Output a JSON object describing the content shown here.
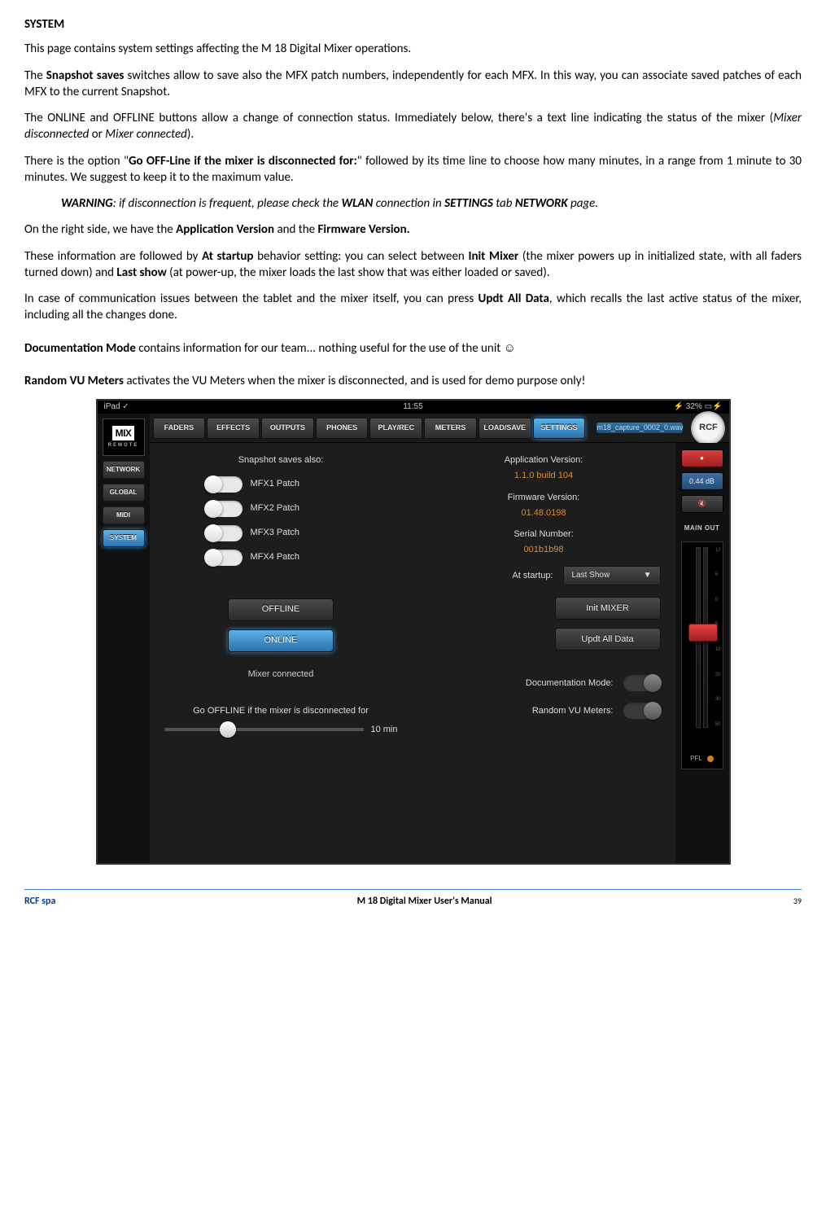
{
  "doc": {
    "section_title": "SYSTEM",
    "p1": "This page contains system settings affecting the M 18 Digital Mixer operations.",
    "p2_a": "The ",
    "p2_b": "Snapshot saves",
    "p2_c": " switches allow to save also the MFX patch numbers, independently for each MFX. In this way, you can associate saved patches of each MFX to the current Snapshot.",
    "p3_a": "The ONLINE and OFFLINE buttons allow a change of connection status. Immediately below, there's a text line indicating the status of the mixer (",
    "p3_b": "Mixer disconnected",
    "p3_c": " or ",
    "p3_d": "Mixer connected",
    "p3_e": ").",
    "p4_a": "There is the option \"",
    "p4_b": "Go OFF-Line if the mixer is disconnected for:",
    "p4_c": "\" followed by its time line to choose how many minutes, in a range from 1 minute to 30 minutes. We suggest to keep it to the maximum value.",
    "p5_a": "WARNING",
    "p5_b": ": if disconnection is frequent, please check the ",
    "p5_c": "WLAN",
    "p5_d": " connection in  ",
    "p5_e": "SETTINGS",
    "p5_f": " tab ",
    "p5_g": "NETWORK",
    "p5_h": " page.",
    "p6_a": "On the right side, we have the ",
    "p6_b": "Application Version",
    "p6_c": " and the ",
    "p6_d": "Firmware Version.",
    "p7_a": "These information are followed by ",
    "p7_b": "At startup",
    "p7_c": " behavior setting: you can select between ",
    "p7_d": "Init Mixer",
    "p7_e": " (the mixer powers up in initialized state, with all faders turned down) and ",
    "p7_f": "Last show",
    "p7_g": "  (at power-up, the mixer loads the last show that was either loaded or saved).",
    "p8_a": "In case of communication issues between the tablet and the mixer itself, you can press ",
    "p8_b": "Updt All Data",
    "p8_c": ", which recalls the last active status of the mixer, including all the changes done.",
    "p9_a": "Documentation Mode",
    "p9_b": " contains information for our team... nothing useful for the use of the unit ☺",
    "p10_a": "Random VU Meters",
    "p10_b": " activates the VU Meters when the mixer is disconnected, and is used for demo purpose only!"
  },
  "footer": {
    "brand": "RCF spa",
    "title": "M 18 Digital Mixer User's Manual",
    "page": "39"
  },
  "app": {
    "statusbar": {
      "device": "iPad",
      "wifi": "",
      "time": "11:55",
      "battery": "32%"
    },
    "logo": {
      "text": "MIX",
      "sub": "REMOTE"
    },
    "tabs": [
      "FADERS",
      "EFFECTS",
      "OUTPUTS",
      "PHONES",
      "PLAY/REC",
      "METERS",
      "LOAD/SAVE",
      "SETTINGS"
    ],
    "active_tab": "SETTINGS",
    "filename": "m18_capture_0002_0.wav",
    "brand": "RCF",
    "sidebar": [
      "NETWORK",
      "GLOBAL",
      "MIDI",
      "SYSTEM"
    ],
    "active_side": "SYSTEM",
    "left": {
      "title": "Snapshot saves also:",
      "toggles": [
        "MFX1 Patch",
        "MFX2 Patch",
        "MFX3 Patch",
        "MFX4 Patch"
      ],
      "offline_btn": "OFFLINE",
      "online_btn": "ONLINE",
      "status": "Mixer connected",
      "disconnect_label": "Go OFFLINE if the mixer is disconnected for",
      "disconnect_value": "10  min"
    },
    "right": {
      "app_ver_label": "Application Version:",
      "app_ver": "1.1.0 build 104",
      "fw_label": "Firmware Version:",
      "fw": "01.48.0198",
      "serial_label": "Serial Number:",
      "serial": "001b1b98",
      "startup_label": "At startup:",
      "startup_value": "Last Show",
      "init_btn": "Init MIXER",
      "updt_btn": "Updt All Data",
      "doc_mode": "Documentation Mode:",
      "random_vu": "Random VU Meters:"
    },
    "rside": {
      "db": "0.44 dB",
      "main": "MAIN OUT",
      "scale": [
        "12",
        "6",
        "0",
        "5",
        "10",
        "20",
        "30",
        "50"
      ],
      "pfl": "PFL"
    }
  }
}
